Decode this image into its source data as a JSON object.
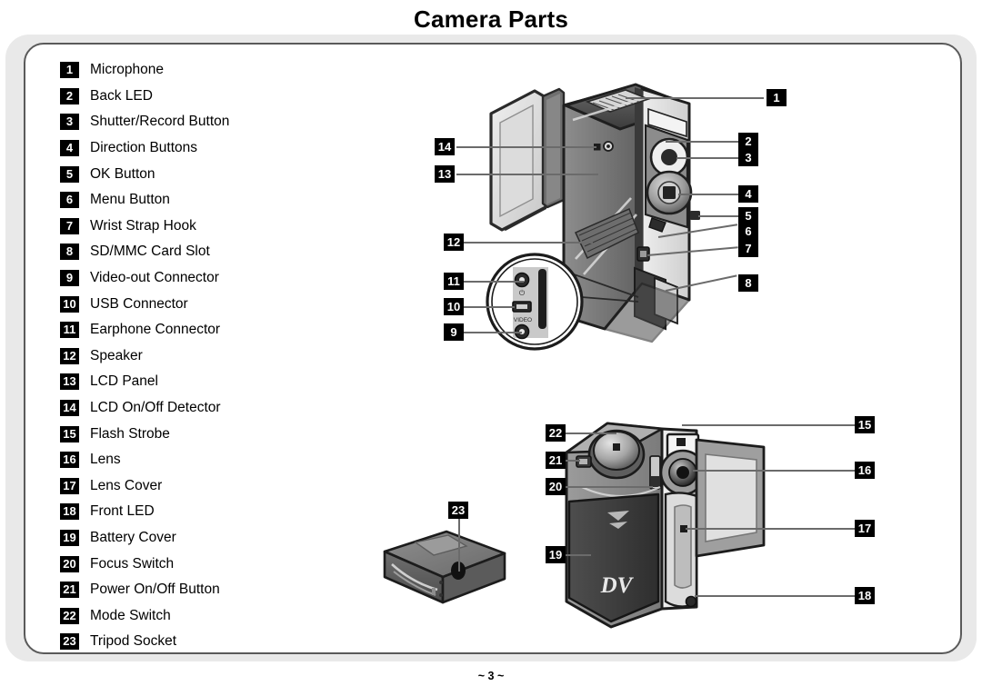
{
  "page": {
    "title": "Camera Parts",
    "footer": "~ 3 ~"
  },
  "parts_list": [
    {
      "num": "1",
      "label": "Microphone"
    },
    {
      "num": "2",
      "label": "Back LED"
    },
    {
      "num": "3",
      "label": "Shutter/Record Button"
    },
    {
      "num": "4",
      "label": "Direction Buttons"
    },
    {
      "num": "5",
      "label": "OK Button"
    },
    {
      "num": "6",
      "label": "Menu Button"
    },
    {
      "num": "7",
      "label": "Wrist Strap Hook"
    },
    {
      "num": "8",
      "label": "SD/MMC Card Slot"
    },
    {
      "num": "9",
      "label": "Video-out Connector"
    },
    {
      "num": "10",
      "label": "USB Connector"
    },
    {
      "num": "11",
      "label": "Earphone Connector"
    },
    {
      "num": "12",
      "label": "Speaker"
    },
    {
      "num": "13",
      "label": "LCD Panel"
    },
    {
      "num": "14",
      "label": "LCD On/Off Detector"
    },
    {
      "num": "15",
      "label": "Flash Strobe"
    },
    {
      "num": "16",
      "label": "Lens"
    },
    {
      "num": "17",
      "label": "Lens Cover"
    },
    {
      "num": "18",
      "label": "Front LED"
    },
    {
      "num": "19",
      "label": "Battery Cover"
    },
    {
      "num": "20",
      "label": "Focus Switch"
    },
    {
      "num": "21",
      "label": "Power On/Off Button"
    },
    {
      "num": "22",
      "label": "Mode Switch"
    },
    {
      "num": "23",
      "label": "Tripod Socket"
    }
  ],
  "figures": {
    "back_view": {
      "name": "camera-back-view",
      "callouts": [
        "1",
        "2",
        "3",
        "4",
        "5",
        "6",
        "7",
        "8",
        "9",
        "10",
        "11",
        "12",
        "13",
        "14"
      ],
      "detail_circle_labels": {
        "video_jack": "VIDEO"
      }
    },
    "front_view": {
      "name": "camera-front-view",
      "callouts": [
        "15",
        "16",
        "17",
        "18",
        "19",
        "20",
        "21",
        "22"
      ],
      "brand_mark": "DV"
    },
    "tripod_view": {
      "name": "camera-bottom-tripod-view",
      "callouts": [
        "23"
      ]
    }
  },
  "colors": {
    "page_background": "#e9e9e9",
    "panel_background": "#ffffff",
    "panel_border": "#5a5a5a",
    "badge_background": "#000000",
    "badge_text": "#ffffff",
    "leader_line": "#6b6b6b",
    "body_dark": "#4a4a4a",
    "body_mid": "#7d7d7d",
    "body_light": "#b9b9b9",
    "body_pale": "#e2e2e2"
  }
}
